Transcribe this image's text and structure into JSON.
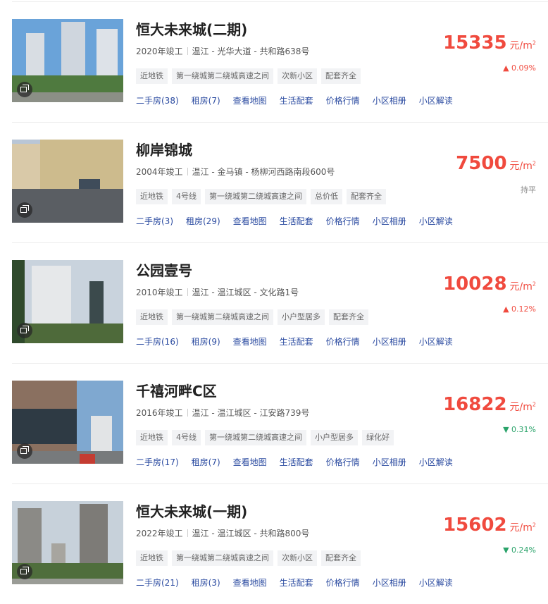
{
  "communities": [
    {
      "name": "恒大未来城(二期)",
      "year": "2020年竣工",
      "location": "温江 - 光华大道 - 共和路638号",
      "tags": [
        "近地铁",
        "第一绕城第二绕城高速之间",
        "次新小区",
        "配套齐全"
      ],
      "price": "15335",
      "unit": "元/m",
      "unit_sup": "2",
      "trend": "up",
      "change_text": "▲ 0.09%",
      "links": [
        "二手房(38)",
        "租房(7)",
        "查看地图",
        "生活配套",
        "价格行情",
        "小区相册",
        "小区解读"
      ],
      "photo": "album-icon"
    },
    {
      "name": "柳岸锦城",
      "year": "2004年竣工",
      "location": "温江 - 金马镇 - 杨柳河西路南段600号",
      "tags": [
        "近地铁",
        "4号线",
        "第一绕城第二绕城高速之间",
        "总价低",
        "配套齐全"
      ],
      "price": "7500",
      "unit": "元/m",
      "unit_sup": "2",
      "trend": "flat",
      "change_text": "持平",
      "links": [
        "二手房(3)",
        "租房(29)",
        "查看地图",
        "生活配套",
        "价格行情",
        "小区相册",
        "小区解读"
      ],
      "photo": "album-icon"
    },
    {
      "name": "公园壹号",
      "year": "2010年竣工",
      "location": "温江 - 温江城区 - 文化路1号",
      "tags": [
        "近地铁",
        "第一绕城第二绕城高速之间",
        "小户型居多",
        "配套齐全"
      ],
      "price": "10028",
      "unit": "元/m",
      "unit_sup": "2",
      "trend": "up",
      "change_text": "▲ 0.12%",
      "links": [
        "二手房(16)",
        "租房(9)",
        "查看地图",
        "生活配套",
        "价格行情",
        "小区相册",
        "小区解读"
      ],
      "photo": "album-icon"
    },
    {
      "name": "千禧河畔C区",
      "year": "2016年竣工",
      "location": "温江 - 温江城区 - 江安路739号",
      "tags": [
        "近地铁",
        "4号线",
        "第一绕城第二绕城高速之间",
        "小户型居多",
        "绿化好"
      ],
      "price": "16822",
      "unit": "元/m",
      "unit_sup": "2",
      "trend": "down",
      "change_text": "▼ 0.31%",
      "links": [
        "二手房(17)",
        "租房(7)",
        "查看地图",
        "生活配套",
        "价格行情",
        "小区相册",
        "小区解读"
      ],
      "photo": "album-icon"
    },
    {
      "name": "恒大未来城(一期)",
      "year": "2022年竣工",
      "location": "温江 - 温江城区 - 共和路800号",
      "tags": [
        "近地铁",
        "第一绕城第二绕城高速之间",
        "次新小区",
        "配套齐全"
      ],
      "price": "15602",
      "unit": "元/m",
      "unit_sup": "2",
      "trend": "down",
      "change_text": "▼ 0.24%",
      "links": [
        "二手房(21)",
        "租房(3)",
        "查看地图",
        "生活配套",
        "价格行情",
        "小区相册",
        "小区解读"
      ],
      "photo": "album-icon"
    }
  ],
  "colors": {
    "price": "#f04a3e",
    "up": "#f04a3e",
    "down": "#2aa36a",
    "flat": "#888888",
    "link": "#2a4aa0"
  }
}
